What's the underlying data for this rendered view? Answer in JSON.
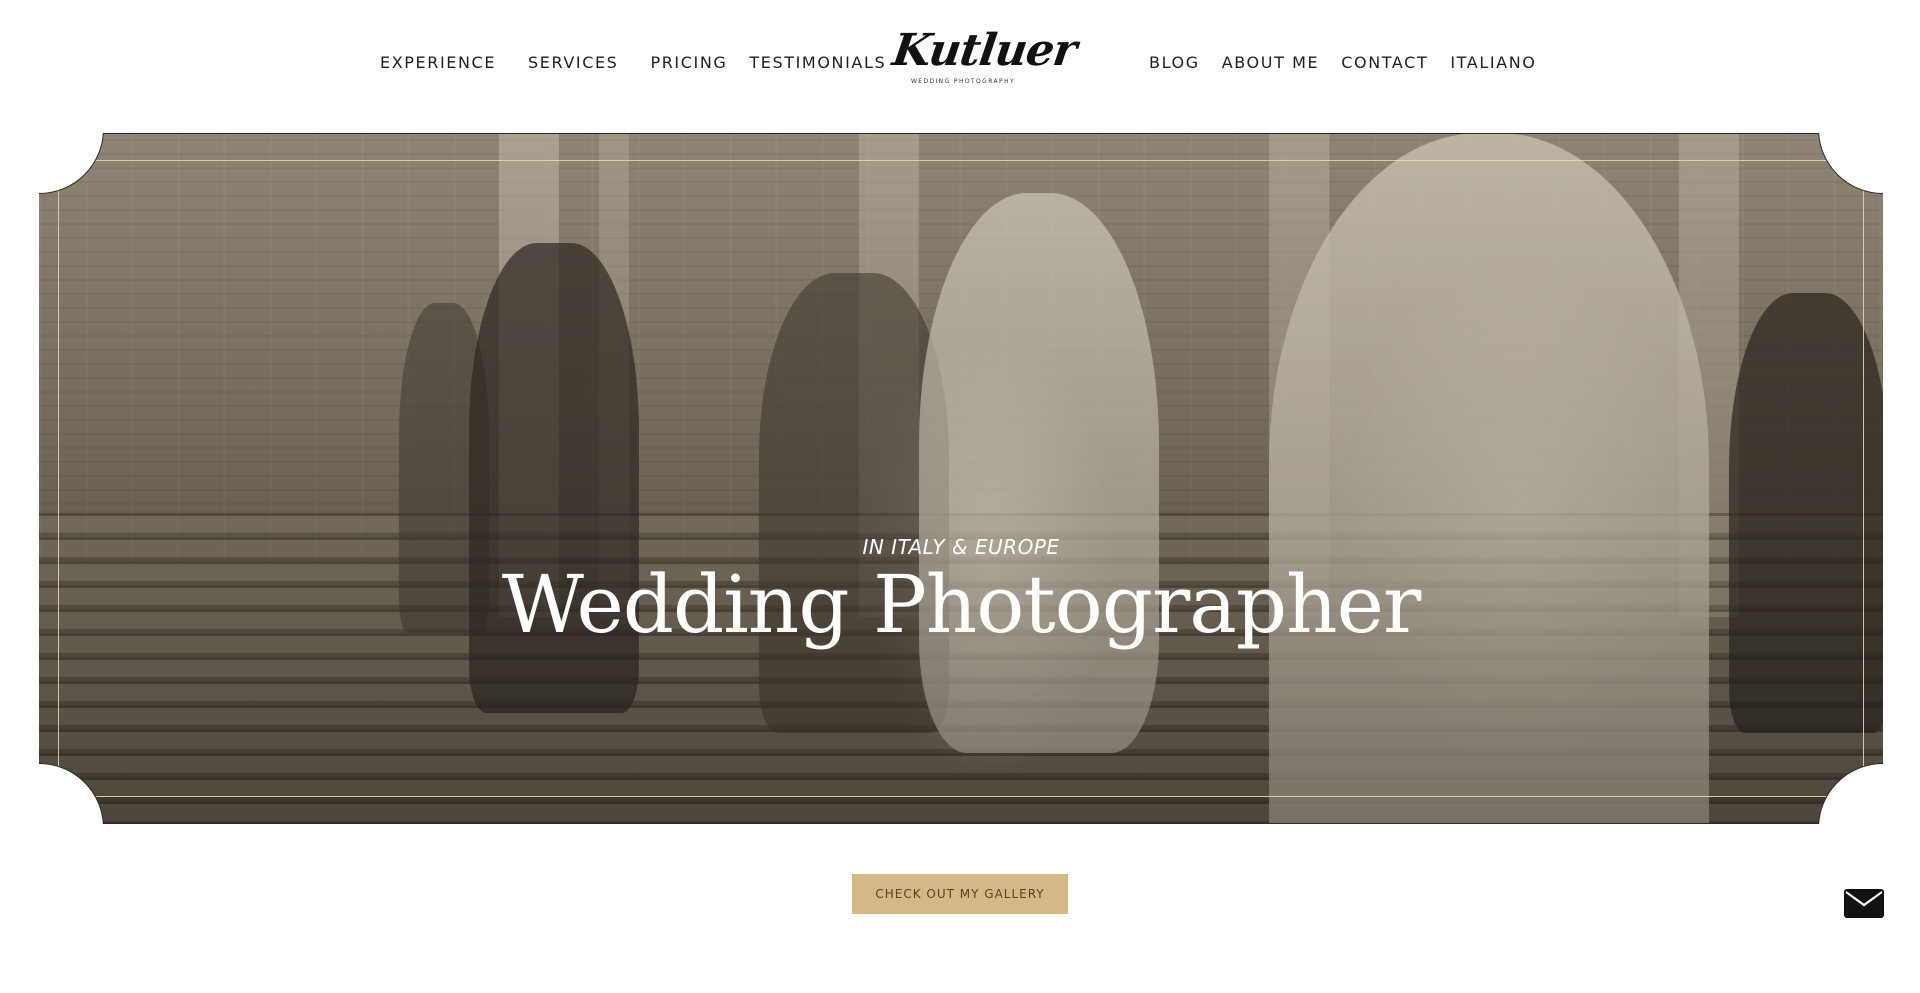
{
  "nav": {
    "left": [
      {
        "label": "EXPERIENCE"
      },
      {
        "label": "SERVICES"
      },
      {
        "label": "PRICING"
      },
      {
        "label": "TESTIMONIALS"
      }
    ],
    "right": [
      {
        "label": "BLOG"
      },
      {
        "label": "ABOUT ME"
      },
      {
        "label": "CONTACT"
      },
      {
        "label": "ITALIANO"
      }
    ]
  },
  "logo": {
    "name": "Kutluer",
    "tagline": "WEDDING PHOTOGRAPHY"
  },
  "hero": {
    "subtitle": "IN ITALY & EUROPE",
    "title": "Wedding Photographer",
    "frame_color": "#e8d6aa"
  },
  "cta": {
    "label": "CHECK OUT MY GALLERY",
    "background": "#d6b886"
  },
  "floating": {
    "icon": "envelope-icon"
  }
}
